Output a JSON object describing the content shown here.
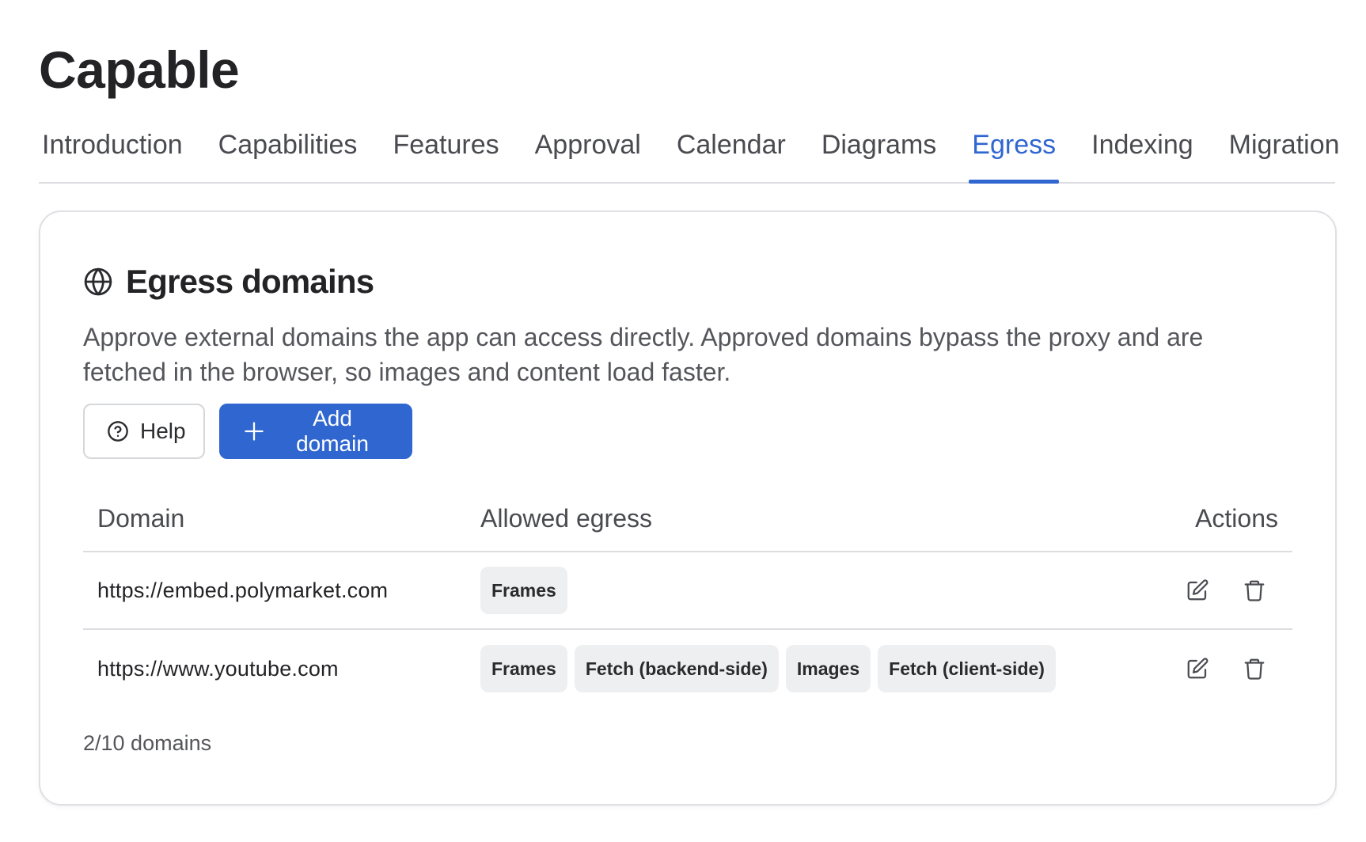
{
  "app": {
    "title": "Capable"
  },
  "tabs": [
    {
      "label": "Introduction",
      "active": false
    },
    {
      "label": "Capabilities",
      "active": false
    },
    {
      "label": "Features",
      "active": false
    },
    {
      "label": "Approval",
      "active": false
    },
    {
      "label": "Calendar",
      "active": false
    },
    {
      "label": "Diagrams",
      "active": false
    },
    {
      "label": "Egress",
      "active": true
    },
    {
      "label": "Indexing",
      "active": false
    },
    {
      "label": "Migration",
      "active": false
    }
  ],
  "card": {
    "icon": "globe-icon",
    "title": "Egress domains",
    "description": "Approve external domains the app can access directly. Approved domains bypass the proxy and are fetched in the browser, so images and content load faster.",
    "help_label": "Help",
    "add_label": "Add domain"
  },
  "table": {
    "headers": {
      "domain": "Domain",
      "egress": "Allowed egress",
      "actions": "Actions"
    },
    "rows": [
      {
        "domain": "https://embed.polymarket.com",
        "egress": [
          "Frames"
        ]
      },
      {
        "domain": "https://www.youtube.com",
        "egress": [
          "Frames",
          "Fetch (backend-side)",
          "Images",
          "Fetch (client-side)"
        ]
      }
    ]
  },
  "footer": {
    "count": "2/10 domains"
  },
  "colors": {
    "accent": "#2f66d0",
    "chip_bg": "#eeeff1",
    "border": "#dcdde0"
  }
}
